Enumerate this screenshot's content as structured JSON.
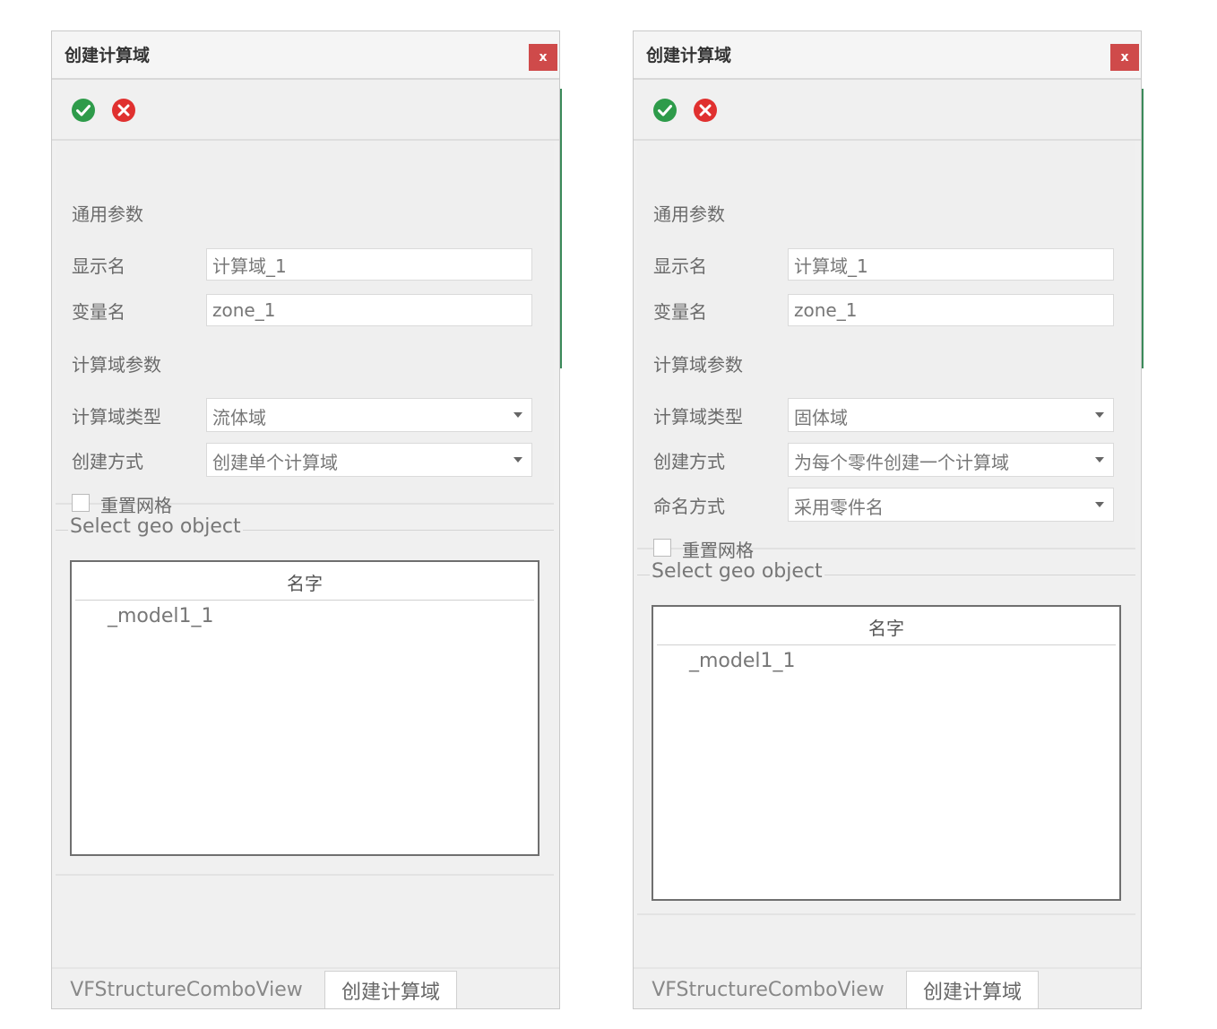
{
  "left_dialog": {
    "title": "创建计算域",
    "close_label": "x",
    "general_section": "通用参数",
    "display_name_label": "显示名",
    "display_name_value": "计算域_1",
    "variable_name_label": "变量名",
    "variable_name_value": "zone_1",
    "domain_section": "计算域参数",
    "domain_type_label": "计算域类型",
    "domain_type_value": "流体域",
    "creation_mode_label": "创建方式",
    "creation_mode_value": "创建单个计算域",
    "remesh_label": "重置网格",
    "geo_group_title": "Select geo object",
    "tree_header": "名字",
    "tree_items": [
      "_model1_1"
    ],
    "tabs": [
      "VFStructureComboView",
      "创建计算域"
    ]
  },
  "right_dialog": {
    "title": "创建计算域",
    "close_label": "x",
    "general_section": "通用参数",
    "display_name_label": "显示名",
    "display_name_value": "计算域_1",
    "variable_name_label": "变量名",
    "variable_name_value": "zone_1",
    "domain_section": "计算域参数",
    "domain_type_label": "计算域类型",
    "domain_type_value": "固体域",
    "creation_mode_label": "创建方式",
    "creation_mode_value": "为每个零件创建一个计算域",
    "naming_mode_label": "命名方式",
    "naming_mode_value": "采用零件名",
    "remesh_label": "重置网格",
    "geo_group_title": "Select geo object",
    "tree_header": "名字",
    "tree_items": [
      "_model1_1"
    ],
    "tabs": [
      "VFStructureComboView",
      "创建计算域"
    ]
  },
  "icons": {
    "accept": "check-circle-icon",
    "reject": "x-circle-icon",
    "dropdown": "chevron-down-icon"
  },
  "colors": {
    "accept": "#2e9b4a",
    "reject": "#e0302f",
    "close": "#cf4a4a"
  }
}
